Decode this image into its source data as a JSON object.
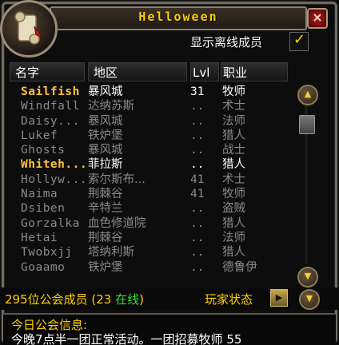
{
  "window": {
    "title": "Helloween",
    "close_label": "×"
  },
  "show_offline": {
    "label": "显示离线成员",
    "checked": true,
    "check_glyph": "✓"
  },
  "columns": {
    "name": "名字",
    "zone": "地区",
    "level": "Lvl",
    "class": "职业"
  },
  "members": [
    {
      "name": "Sailfish",
      "zone": "暴风城",
      "level": "31",
      "class": "牧师",
      "online": true
    },
    {
      "name": "Windfall",
      "zone": "达纳苏斯",
      "level": "..",
      "class": "术士",
      "online": false
    },
    {
      "name": "Daisy...",
      "zone": "暴风城",
      "level": "..",
      "class": "法师",
      "online": false
    },
    {
      "name": "Lukef",
      "zone": "铁炉堡",
      "level": "..",
      "class": "猎人",
      "online": false
    },
    {
      "name": "Ghosts",
      "zone": "暴风城",
      "level": "..",
      "class": "战士",
      "online": false
    },
    {
      "name": "Whiteh...",
      "zone": "菲拉斯",
      "level": "..",
      "class": "猎人",
      "online": true
    },
    {
      "name": "Hollyw...",
      "zone": "索尔斯布...",
      "level": "41",
      "class": "术士",
      "online": false
    },
    {
      "name": "Naima",
      "zone": "荆棘谷",
      "level": "41",
      "class": "牧师",
      "online": false
    },
    {
      "name": "Dsiben",
      "zone": "辛特兰",
      "level": "..",
      "class": "盗贼",
      "online": false
    },
    {
      "name": "Gorzalka",
      "zone": "血色修道院",
      "level": "..",
      "class": "猎人",
      "online": false
    },
    {
      "name": "Hetai",
      "zone": "荆棘谷",
      "level": "..",
      "class": "法师",
      "online": false
    },
    {
      "name": "Twobxjj",
      "zone": "塔纳利斯",
      "level": "..",
      "class": "猎人",
      "online": false
    },
    {
      "name": "Goaamo",
      "zone": "铁炉堡",
      "level": "..",
      "class": "德鲁伊",
      "online": false
    }
  ],
  "footer": {
    "members_prefix": "295位公会成员 (23 ",
    "online_word": "在线",
    "members_suffix": ")",
    "player_status": "玩家状态"
  },
  "motd": {
    "title": "今日公会信息:",
    "text": "今晚7点半一团正常活动。一团招募牧师 55"
  },
  "colors": {
    "gold": "#ffd000",
    "online_name": "#ffc33a",
    "offline": "#8a8a8a",
    "online_count": "#33dd33"
  }
}
